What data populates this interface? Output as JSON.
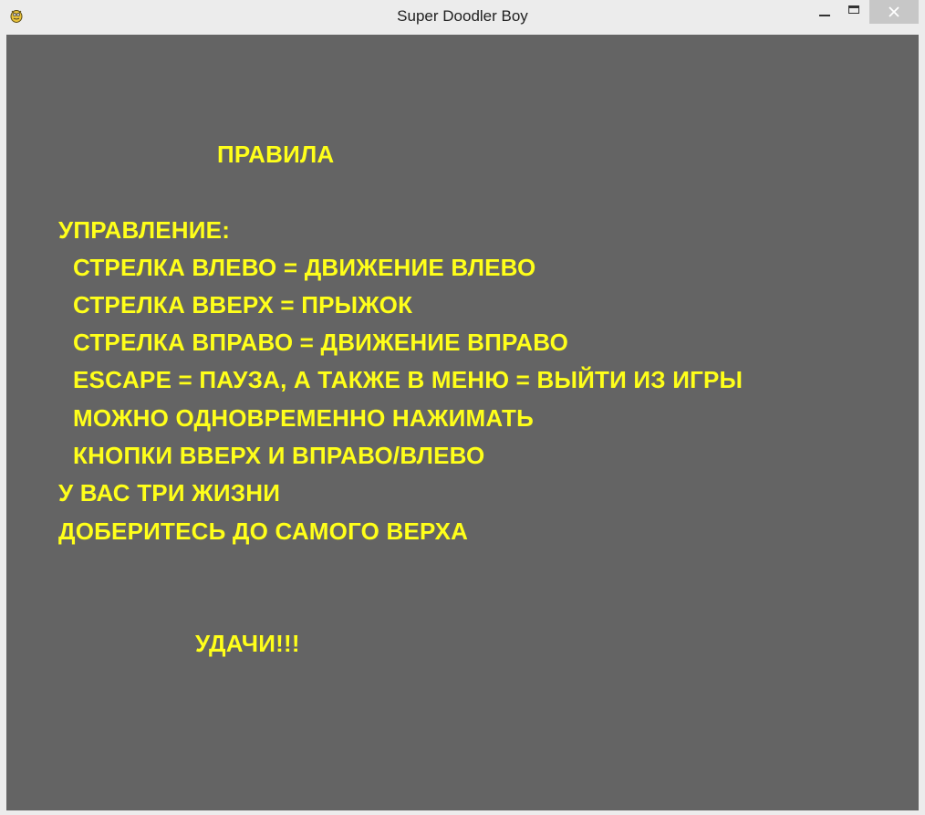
{
  "window": {
    "title": "Super Doodler Boy",
    "icon": "pygame-snake-icon",
    "controls": [
      "minimize-icon",
      "maximize-icon",
      "close-icon"
    ]
  },
  "colors": {
    "background": "#646464",
    "text": "#ffff1a"
  },
  "rules": {
    "heading": "ПРАВИЛА",
    "controls_heading": "УПРАВЛЕНИЕ:",
    "lines": [
      "СТРЕЛКА ВЛЕВО = ДВИЖЕНИЕ ВЛЕВО",
      "СТРЕЛКА ВВЕРХ = ПРЫЖОК",
      "СТРЕЛКА ВПРАВО = ДВИЖЕНИЕ ВПРАВО",
      "ESCAPE = ПАУЗА, А ТАКЖЕ В МЕНЮ = ВЫЙТИ ИЗ ИГРЫ",
      "МОЖНО ОДНОВРЕМЕННО НАЖИМАТЬ",
      "КНОПКИ ВВЕРХ И ВПРАВО/ВЛЕВО"
    ],
    "lives": "У ВАС ТРИ ЖИЗНИ",
    "goal": "ДОБЕРИТЕСЬ ДО САМОГО ВЕРХА",
    "farewell": "УДАЧИ!!!"
  }
}
